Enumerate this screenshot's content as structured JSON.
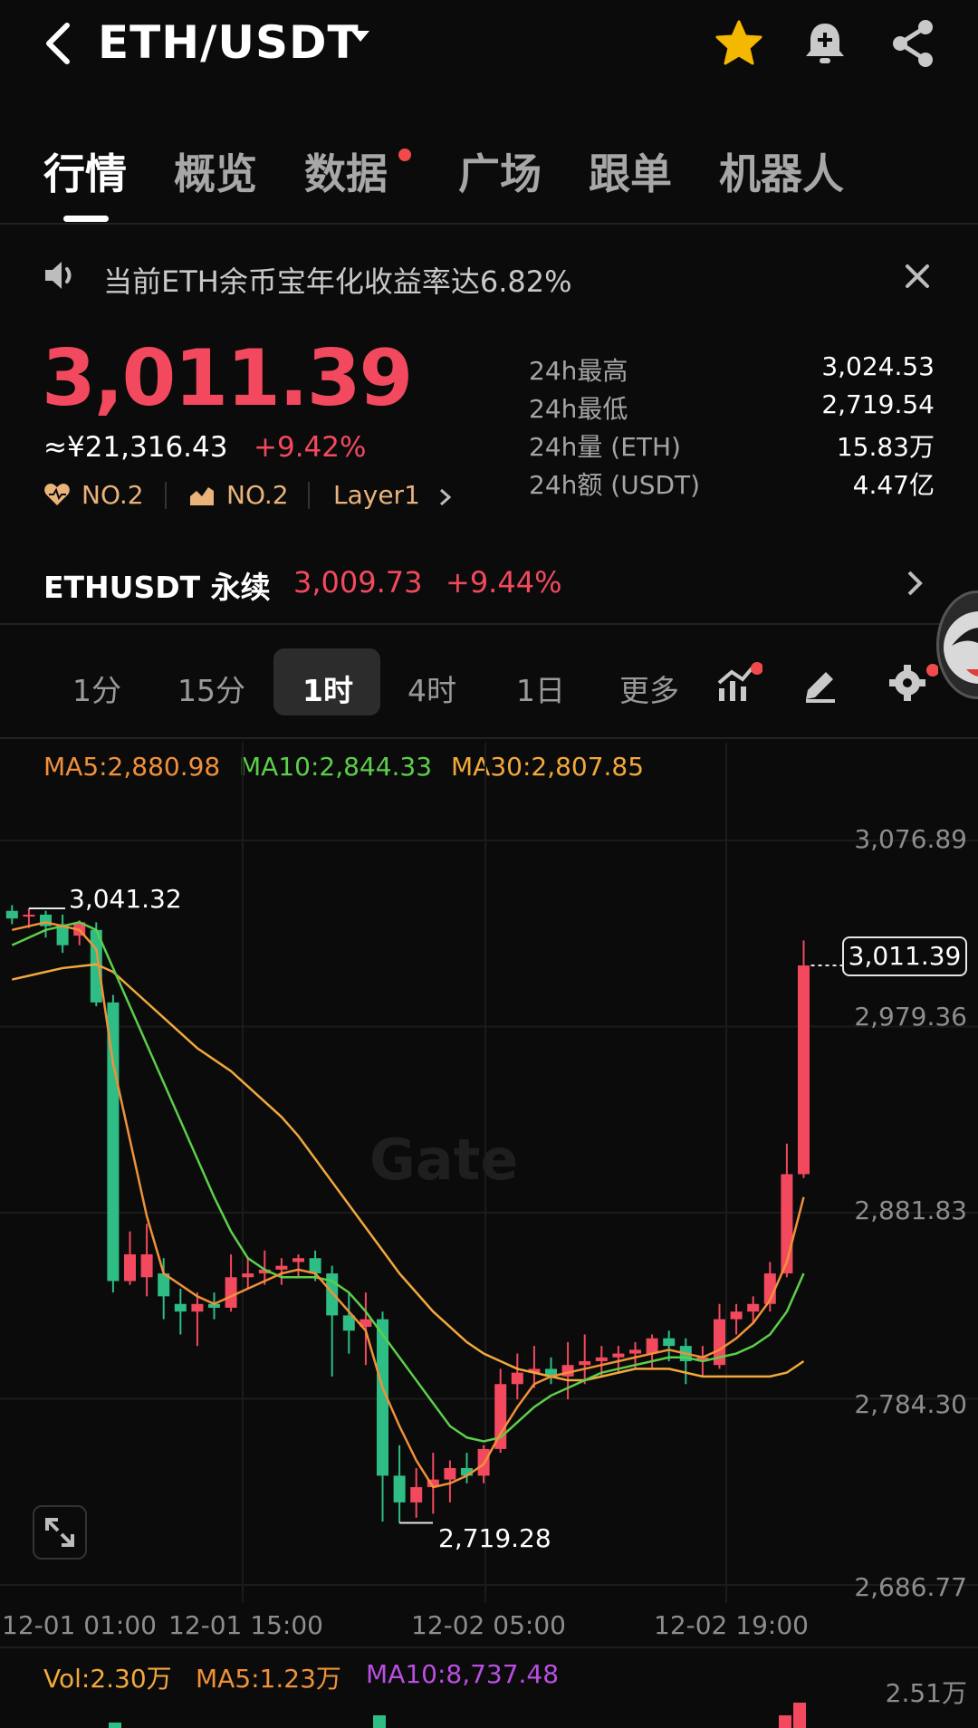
{
  "header": {
    "pair": "ETH/USDT"
  },
  "tabs": [
    {
      "label": "行情",
      "active": true
    },
    {
      "label": "概览",
      "active": false
    },
    {
      "label": "数据",
      "active": false,
      "dot": true
    },
    {
      "label": "广场",
      "active": false
    },
    {
      "label": "跟单",
      "active": false
    },
    {
      "label": "机器人",
      "active": false
    }
  ],
  "announcement": {
    "text": "当前ETH余币宝年化收益率达6.82%"
  },
  "ticker": {
    "last_price": "3,011.39",
    "cny_price": "≈¥21,316.43",
    "change": "+9.42%",
    "tags": [
      "NO.2",
      "NO.2",
      "Layer1"
    ],
    "stats": [
      {
        "label": "24h最高",
        "value": "3,024.53"
      },
      {
        "label": "24h最低",
        "value": "2,719.54"
      },
      {
        "label": "24h量 (ETH)",
        "value": "15.83万"
      },
      {
        "label": "24h额 (USDT)",
        "value": "4.47亿"
      }
    ]
  },
  "perpetual": {
    "name": "ETHUSDT 永续",
    "price": "3,009.73",
    "change": "+9.44%"
  },
  "intervals": [
    "1分",
    "15分",
    "1时",
    "4时",
    "1日",
    "更多"
  ],
  "active_interval": "1时",
  "ma_legend": {
    "ma5": "MA5:2,880.98",
    "ma10": "MA10:2,844.33",
    "ma30": "MA30:2,807.85"
  },
  "colors": {
    "up": "#f2495e",
    "down": "#2ebd85",
    "ma5": "#f0913a",
    "ma10": "#5ccf4a",
    "ma30": "#f2a93b",
    "vol": "#f2a93b",
    "ma10_vol": "#b84fe0"
  },
  "chart_data": {
    "type": "candlestick",
    "price_axis": [
      "3,076.89",
      "2,979.36",
      "2,881.83",
      "2,784.30",
      "2,686.77"
    ],
    "ylim": [
      2686.77,
      3076.89
    ],
    "x_labels": [
      "12-01 01:00",
      "12-01 15:00",
      "12-02 05:00",
      "12-02 19:00"
    ],
    "high_annotation": "3,041.32",
    "low_annotation": "2,719.28",
    "current_price_tag": "3,011.39",
    "watermark": "Gate",
    "candles": [
      {
        "o": 3040,
        "h": 3043,
        "l": 3033,
        "c": 3036
      },
      {
        "o": 3037,
        "h": 3041.32,
        "l": 3031,
        "c": 3038
      },
      {
        "o": 3038,
        "h": 3040,
        "l": 3026,
        "c": 3032
      },
      {
        "o": 3033,
        "h": 3038,
        "l": 3018,
        "c": 3022
      },
      {
        "o": 3027,
        "h": 3035,
        "l": 3022,
        "c": 3034
      },
      {
        "o": 3030,
        "h": 3034,
        "l": 2990,
        "c": 2992
      },
      {
        "o": 2992,
        "h": 2996,
        "l": 2840,
        "c": 2846
      },
      {
        "o": 2846,
        "h": 2872,
        "l": 2844,
        "c": 2860
      },
      {
        "o": 2848,
        "h": 2876,
        "l": 2838,
        "c": 2860
      },
      {
        "o": 2850,
        "h": 2858,
        "l": 2826,
        "c": 2838
      },
      {
        "o": 2834,
        "h": 2842,
        "l": 2818,
        "c": 2830
      },
      {
        "o": 2830,
        "h": 2840,
        "l": 2812,
        "c": 2834
      },
      {
        "o": 2834,
        "h": 2840,
        "l": 2826,
        "c": 2832
      },
      {
        "o": 2832,
        "h": 2860,
        "l": 2830,
        "c": 2848
      },
      {
        "o": 2848,
        "h": 2858,
        "l": 2842,
        "c": 2850
      },
      {
        "o": 2850,
        "h": 2862,
        "l": 2844,
        "c": 2852
      },
      {
        "o": 2852,
        "h": 2858,
        "l": 2844,
        "c": 2854
      },
      {
        "o": 2856,
        "h": 2860,
        "l": 2848,
        "c": 2858
      },
      {
        "o": 2858,
        "h": 2862,
        "l": 2846,
        "c": 2850
      },
      {
        "o": 2850,
        "h": 2854,
        "l": 2796,
        "c": 2828
      },
      {
        "o": 2828,
        "h": 2840,
        "l": 2808,
        "c": 2820
      },
      {
        "o": 2822,
        "h": 2840,
        "l": 2802,
        "c": 2826
      },
      {
        "o": 2826,
        "h": 2830,
        "l": 2720,
        "c": 2744
      },
      {
        "o": 2744,
        "h": 2760,
        "l": 2719.28,
        "c": 2730
      },
      {
        "o": 2730,
        "h": 2748,
        "l": 2722,
        "c": 2738
      },
      {
        "o": 2738,
        "h": 2756,
        "l": 2724,
        "c": 2742
      },
      {
        "o": 2742,
        "h": 2752,
        "l": 2730,
        "c": 2748
      },
      {
        "o": 2748,
        "h": 2756,
        "l": 2740,
        "c": 2744
      },
      {
        "o": 2744,
        "h": 2760,
        "l": 2740,
        "c": 2758
      },
      {
        "o": 2758,
        "h": 2800,
        "l": 2756,
        "c": 2792
      },
      {
        "o": 2792,
        "h": 2808,
        "l": 2784,
        "c": 2798
      },
      {
        "o": 2798,
        "h": 2812,
        "l": 2790,
        "c": 2800
      },
      {
        "o": 2800,
        "h": 2806,
        "l": 2792,
        "c": 2796
      },
      {
        "o": 2796,
        "h": 2814,
        "l": 2784,
        "c": 2802
      },
      {
        "o": 2802,
        "h": 2818,
        "l": 2792,
        "c": 2804
      },
      {
        "o": 2804,
        "h": 2812,
        "l": 2796,
        "c": 2806
      },
      {
        "o": 2806,
        "h": 2812,
        "l": 2798,
        "c": 2808
      },
      {
        "o": 2808,
        "h": 2814,
        "l": 2800,
        "c": 2810
      },
      {
        "o": 2808,
        "h": 2818,
        "l": 2800,
        "c": 2816
      },
      {
        "o": 2816,
        "h": 2820,
        "l": 2804,
        "c": 2812
      },
      {
        "o": 2812,
        "h": 2816,
        "l": 2792,
        "c": 2804
      },
      {
        "o": 2804,
        "h": 2812,
        "l": 2796,
        "c": 2806
      },
      {
        "o": 2802,
        "h": 2834,
        "l": 2800,
        "c": 2826
      },
      {
        "o": 2826,
        "h": 2834,
        "l": 2818,
        "c": 2830
      },
      {
        "o": 2830,
        "h": 2838,
        "l": 2824,
        "c": 2834
      },
      {
        "o": 2834,
        "h": 2856,
        "l": 2830,
        "c": 2850
      },
      {
        "o": 2850,
        "h": 2918,
        "l": 2848,
        "c": 2902
      },
      {
        "o": 2902,
        "h": 3024.53,
        "l": 2900,
        "c": 3011.39
      }
    ],
    "ma5": [
      3030,
      3032,
      3034,
      3032,
      3030,
      3020,
      2960,
      2920,
      2880,
      2850,
      2844,
      2838,
      2834,
      2838,
      2842,
      2846,
      2850,
      2852,
      2850,
      2840,
      2830,
      2820,
      2790,
      2770,
      2752,
      2738,
      2740,
      2744,
      2750,
      2766,
      2780,
      2792,
      2796,
      2798,
      2800,
      2802,
      2804,
      2806,
      2808,
      2810,
      2808,
      2806,
      2810,
      2816,
      2824,
      2836,
      2856,
      2890
    ],
    "ma10": [
      3022,
      3026,
      3030,
      3032,
      3034,
      3030,
      3010,
      2990,
      2970,
      2950,
      2930,
      2910,
      2890,
      2872,
      2858,
      2852,
      2848,
      2848,
      2848,
      2846,
      2840,
      2830,
      2818,
      2806,
      2794,
      2782,
      2770,
      2764,
      2762,
      2764,
      2772,
      2780,
      2786,
      2790,
      2794,
      2798,
      2800,
      2802,
      2804,
      2806,
      2806,
      2804,
      2806,
      2808,
      2812,
      2818,
      2830,
      2850
    ],
    "ma30": [
      3004,
      3006,
      3008,
      3010,
      3011,
      3012,
      3008,
      3000,
      2992,
      2984,
      2976,
      2968,
      2962,
      2956,
      2948,
      2940,
      2932,
      2922,
      2910,
      2898,
      2886,
      2874,
      2862,
      2850,
      2840,
      2830,
      2822,
      2814,
      2808,
      2804,
      2800,
      2798,
      2796,
      2794,
      2794,
      2796,
      2798,
      2800,
      2800,
      2800,
      2798,
      2796,
      2796,
      2796,
      2796,
      2796,
      2798,
      2804
    ]
  },
  "volume": {
    "vol": "Vol:2.30万",
    "ma5": "MA5:1.23万",
    "ma10": "MA10:8,737.48",
    "max_label": "2.51万"
  }
}
